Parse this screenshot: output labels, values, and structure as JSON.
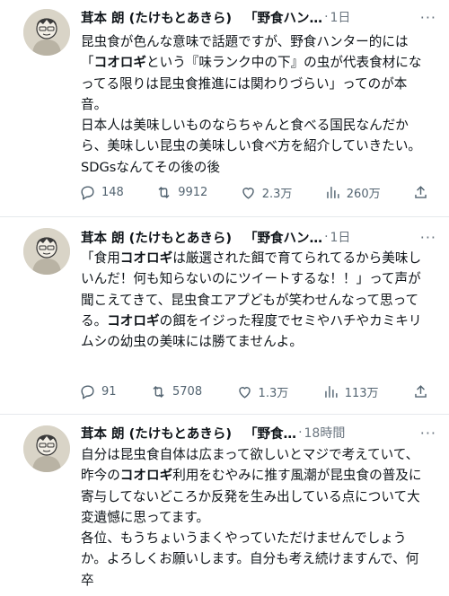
{
  "tweets": [
    {
      "name": "茸本 朗 (たけもとあきら)",
      "handle": "「野食ハン…",
      "time": "1日",
      "body_parts": [
        {
          "text": "昆虫食が色んな意味で話題ですが、野食ハンター的には「",
          "bold": false
        },
        {
          "text": "コオロギ",
          "bold": true
        },
        {
          "text": "という『味ランク中の下』の虫が代表食材になってる限りは昆虫食推進には関わりづらい」ってのが本音。\n日本人は美味しいものならちゃんと食べる国民なんだから、美味しい昆虫の美味しい食べ方を紹介していきたい。SDGsなんてその後の後",
          "bold": false
        }
      ],
      "stats": {
        "replies": "148",
        "retweets": "9912",
        "likes": "2.3万",
        "views": "260万"
      }
    },
    {
      "name": "茸本 朗 (たけもとあきら)",
      "handle": "「野食ハン…",
      "time": "1日",
      "body_parts": [
        {
          "text": "「食用",
          "bold": false
        },
        {
          "text": "コオロギ",
          "bold": true
        },
        {
          "text": "は厳選された餌で育てられてるから美味しいんだ！何も知らないのにツイートするな！！」って声が聞こえてきて、昆虫食エアプどもが笑わせんなって思ってる。",
          "bold": false
        },
        {
          "text": "コオロギ",
          "bold": true
        },
        {
          "text": "の餌をイジった程度でセミやハチやカミキリムシの幼虫の美味には勝てませんよ。",
          "bold": false
        }
      ],
      "stats": {
        "replies": "91",
        "retweets": "5708",
        "likes": "1.3万",
        "views": "113万"
      }
    },
    {
      "name": "茸本 朗 (たけもとあきら)",
      "handle": "「野食…",
      "time": "18時間",
      "body_parts": [
        {
          "text": "自分は昆虫食自体は広まって欲しいとマジで考えていて、昨今の",
          "bold": false
        },
        {
          "text": "コオロギ",
          "bold": true
        },
        {
          "text": "利用をむやみに推す風潮が昆虫食の普及に寄与してないどころか反発を生み出している点について大変遺憾に思ってます。\n各位、もうちょいうまくやっていただけませんでしょうか。よろしくお願いします。自分も考え続けますんで、何卒",
          "bold": false
        }
      ]
    }
  ]
}
